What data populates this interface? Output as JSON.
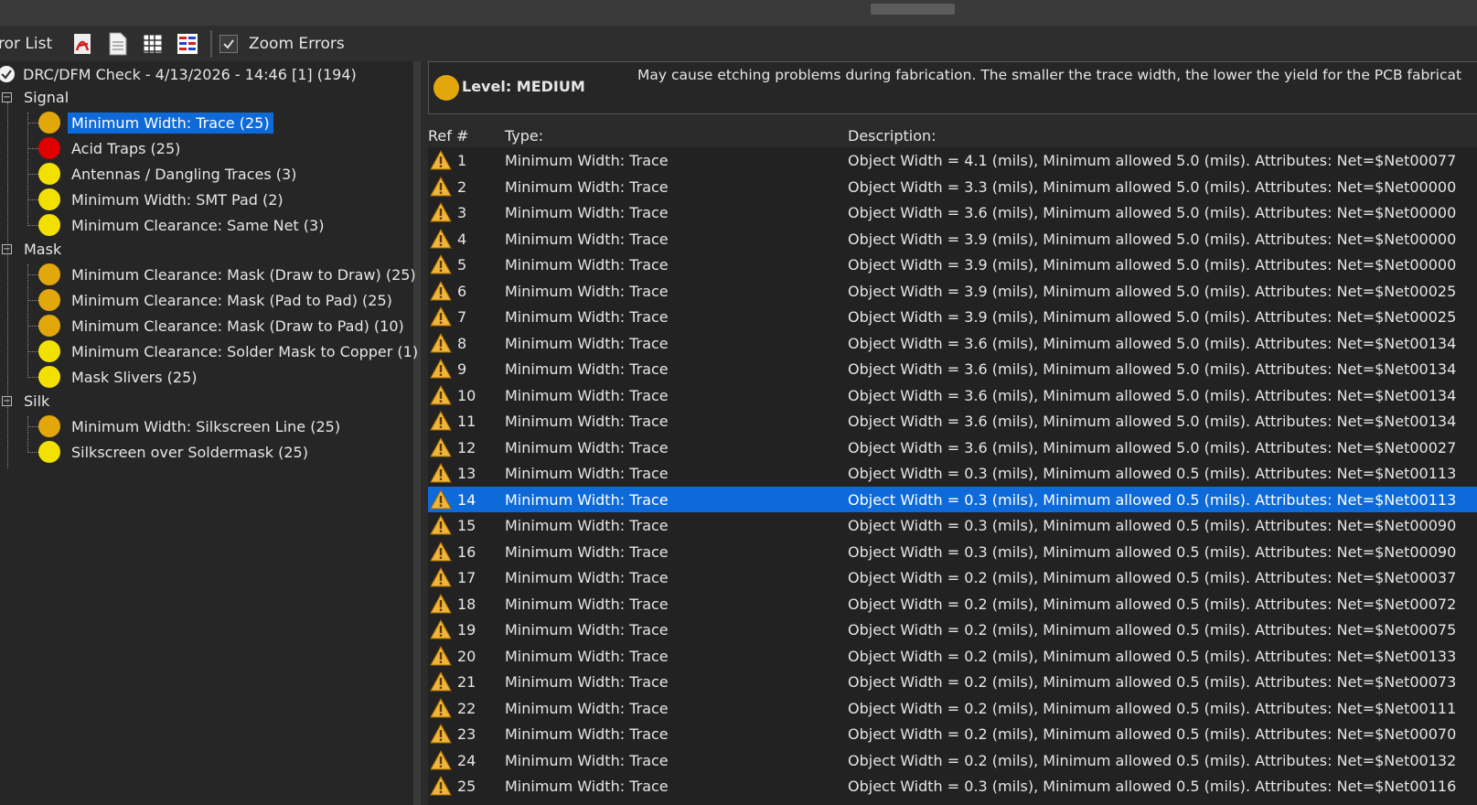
{
  "toolbar": {
    "title": "ror List",
    "zoom_label": "Zoom Errors",
    "zoom_checked": true
  },
  "colors": {
    "medium": "#e2a70b",
    "low": "#f2e100",
    "high": "#e00000",
    "selection": "#0e6ad8"
  },
  "tree": {
    "root": "DRC/DFM Check - 4/13/2026 - 14:46 [1] (194)",
    "groups": [
      {
        "label": "Signal",
        "items": [
          {
            "label": "Minimum Width: Trace (25)",
            "severity": "medium",
            "selected": true
          },
          {
            "label": "Acid Traps (25)",
            "severity": "high"
          },
          {
            "label": "Antennas / Dangling Traces (3)",
            "severity": "low"
          },
          {
            "label": "Minimum Width: SMT Pad (2)",
            "severity": "low"
          },
          {
            "label": "Minimum Clearance: Same Net (3)",
            "severity": "low"
          }
        ]
      },
      {
        "label": "Mask",
        "items": [
          {
            "label": "Minimum Clearance: Mask (Draw to Draw) (25)",
            "severity": "medium"
          },
          {
            "label": "Minimum Clearance: Mask (Pad to Pad) (25)",
            "severity": "medium"
          },
          {
            "label": "Minimum Clearance: Mask (Draw to Pad) (10)",
            "severity": "medium"
          },
          {
            "label": "Minimum Clearance: Solder Mask to Copper (1)",
            "severity": "low"
          },
          {
            "label": "Mask Slivers (25)",
            "severity": "low"
          }
        ]
      },
      {
        "label": "Silk",
        "items": [
          {
            "label": "Minimum Width: Silkscreen Line (25)",
            "severity": "medium"
          },
          {
            "label": "Silkscreen over Soldermask (25)",
            "severity": "low"
          }
        ]
      }
    ]
  },
  "level": {
    "label": "Level: MEDIUM",
    "description": "May cause etching problems during fabrication. The smaller the trace width, the lower the yield for the PCB fabricat"
  },
  "table": {
    "headers": {
      "ref": "Ref #",
      "type": "Type:",
      "description": "Description:"
    },
    "selected_index": 13,
    "rows": [
      {
        "ref": "1",
        "type": "Minimum Width: Trace",
        "desc": "Object Width = 4.1 (mils), Minimum allowed 5.0 (mils).  Attributes: Net=$Net00077"
      },
      {
        "ref": "2",
        "type": "Minimum Width: Trace",
        "desc": "Object Width = 3.3 (mils), Minimum allowed 5.0 (mils).  Attributes: Net=$Net00000"
      },
      {
        "ref": "3",
        "type": "Minimum Width: Trace",
        "desc": "Object Width = 3.6 (mils), Minimum allowed 5.0 (mils).  Attributes: Net=$Net00000"
      },
      {
        "ref": "4",
        "type": "Minimum Width: Trace",
        "desc": "Object Width = 3.9 (mils), Minimum allowed 5.0 (mils).  Attributes: Net=$Net00000"
      },
      {
        "ref": "5",
        "type": "Minimum Width: Trace",
        "desc": "Object Width = 3.9 (mils), Minimum allowed 5.0 (mils).  Attributes: Net=$Net00000"
      },
      {
        "ref": "6",
        "type": "Minimum Width: Trace",
        "desc": "Object Width = 3.9 (mils), Minimum allowed 5.0 (mils).  Attributes: Net=$Net00025"
      },
      {
        "ref": "7",
        "type": "Minimum Width: Trace",
        "desc": "Object Width = 3.9 (mils), Minimum allowed 5.0 (mils).  Attributes: Net=$Net00025"
      },
      {
        "ref": "8",
        "type": "Minimum Width: Trace",
        "desc": "Object Width = 3.6 (mils), Minimum allowed 5.0 (mils).  Attributes: Net=$Net00134"
      },
      {
        "ref": "9",
        "type": "Minimum Width: Trace",
        "desc": "Object Width = 3.6 (mils), Minimum allowed 5.0 (mils).  Attributes: Net=$Net00134"
      },
      {
        "ref": "10",
        "type": "Minimum Width: Trace",
        "desc": "Object Width = 3.6 (mils), Minimum allowed 5.0 (mils).  Attributes: Net=$Net00134"
      },
      {
        "ref": "11",
        "type": "Minimum Width: Trace",
        "desc": "Object Width = 3.6 (mils), Minimum allowed 5.0 (mils).  Attributes: Net=$Net00134"
      },
      {
        "ref": "12",
        "type": "Minimum Width: Trace",
        "desc": "Object Width = 3.6 (mils), Minimum allowed 5.0 (mils).  Attributes: Net=$Net00027"
      },
      {
        "ref": "13",
        "type": "Minimum Width: Trace",
        "desc": "Object Width = 0.3 (mils), Minimum allowed 0.5 (mils).  Attributes: Net=$Net00113"
      },
      {
        "ref": "14",
        "type": "Minimum Width: Trace",
        "desc": "Object Width = 0.3 (mils), Minimum allowed 0.5 (mils).  Attributes: Net=$Net00113"
      },
      {
        "ref": "15",
        "type": "Minimum Width: Trace",
        "desc": "Object Width = 0.3 (mils), Minimum allowed 0.5 (mils).  Attributes: Net=$Net00090"
      },
      {
        "ref": "16",
        "type": "Minimum Width: Trace",
        "desc": "Object Width = 0.3 (mils), Minimum allowed 0.5 (mils).  Attributes: Net=$Net00090"
      },
      {
        "ref": "17",
        "type": "Minimum Width: Trace",
        "desc": "Object Width = 0.2 (mils), Minimum allowed 0.5 (mils).  Attributes: Net=$Net00037"
      },
      {
        "ref": "18",
        "type": "Minimum Width: Trace",
        "desc": "Object Width = 0.2 (mils), Minimum allowed 0.5 (mils).  Attributes: Net=$Net00072"
      },
      {
        "ref": "19",
        "type": "Minimum Width: Trace",
        "desc": "Object Width = 0.2 (mils), Minimum allowed 0.5 (mils).  Attributes: Net=$Net00075"
      },
      {
        "ref": "20",
        "type": "Minimum Width: Trace",
        "desc": "Object Width = 0.2 (mils), Minimum allowed 0.5 (mils).  Attributes: Net=$Net00133"
      },
      {
        "ref": "21",
        "type": "Minimum Width: Trace",
        "desc": "Object Width = 0.2 (mils), Minimum allowed 0.5 (mils).  Attributes: Net=$Net00073"
      },
      {
        "ref": "22",
        "type": "Minimum Width: Trace",
        "desc": "Object Width = 0.2 (mils), Minimum allowed 0.5 (mils).  Attributes: Net=$Net00111"
      },
      {
        "ref": "23",
        "type": "Minimum Width: Trace",
        "desc": "Object Width = 0.2 (mils), Minimum allowed 0.5 (mils).  Attributes: Net=$Net00070"
      },
      {
        "ref": "24",
        "type": "Minimum Width: Trace",
        "desc": "Object Width = 0.2 (mils), Minimum allowed 0.5 (mils).  Attributes: Net=$Net00132"
      },
      {
        "ref": "25",
        "type": "Minimum Width: Trace",
        "desc": "Object Width = 0.3 (mils), Minimum allowed 0.5 (mils).  Attributes: Net=$Net00116"
      }
    ]
  }
}
